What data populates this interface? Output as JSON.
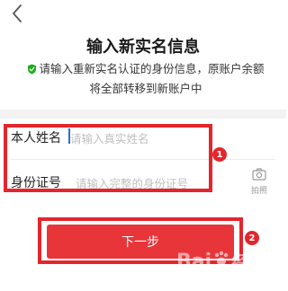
{
  "header": {
    "title": "输入新实名信息",
    "notice_line1": "请输入重新实名认证的身份信息，原账户余额",
    "notice_line2": "将全部转移到新账户中"
  },
  "form": {
    "name_label": "本人姓名",
    "name_placeholder": "请输入真实姓名",
    "id_label": "身份证号",
    "id_placeholder": "请输入完整的身份证号",
    "camera_label": "拍照"
  },
  "annotations": {
    "badge1": "1",
    "badge2": "2"
  },
  "actions": {
    "next_label": "下一步"
  },
  "watermark": {
    "text_left": "Bai",
    "text_right": "经验"
  },
  "colors": {
    "accent_red": "#e3262d",
    "button_red": "#e8353a",
    "shield_green": "#1aad19"
  },
  "icons": {
    "back": "chevron-left-icon",
    "shield": "shield-check-icon",
    "camera": "camera-icon"
  }
}
